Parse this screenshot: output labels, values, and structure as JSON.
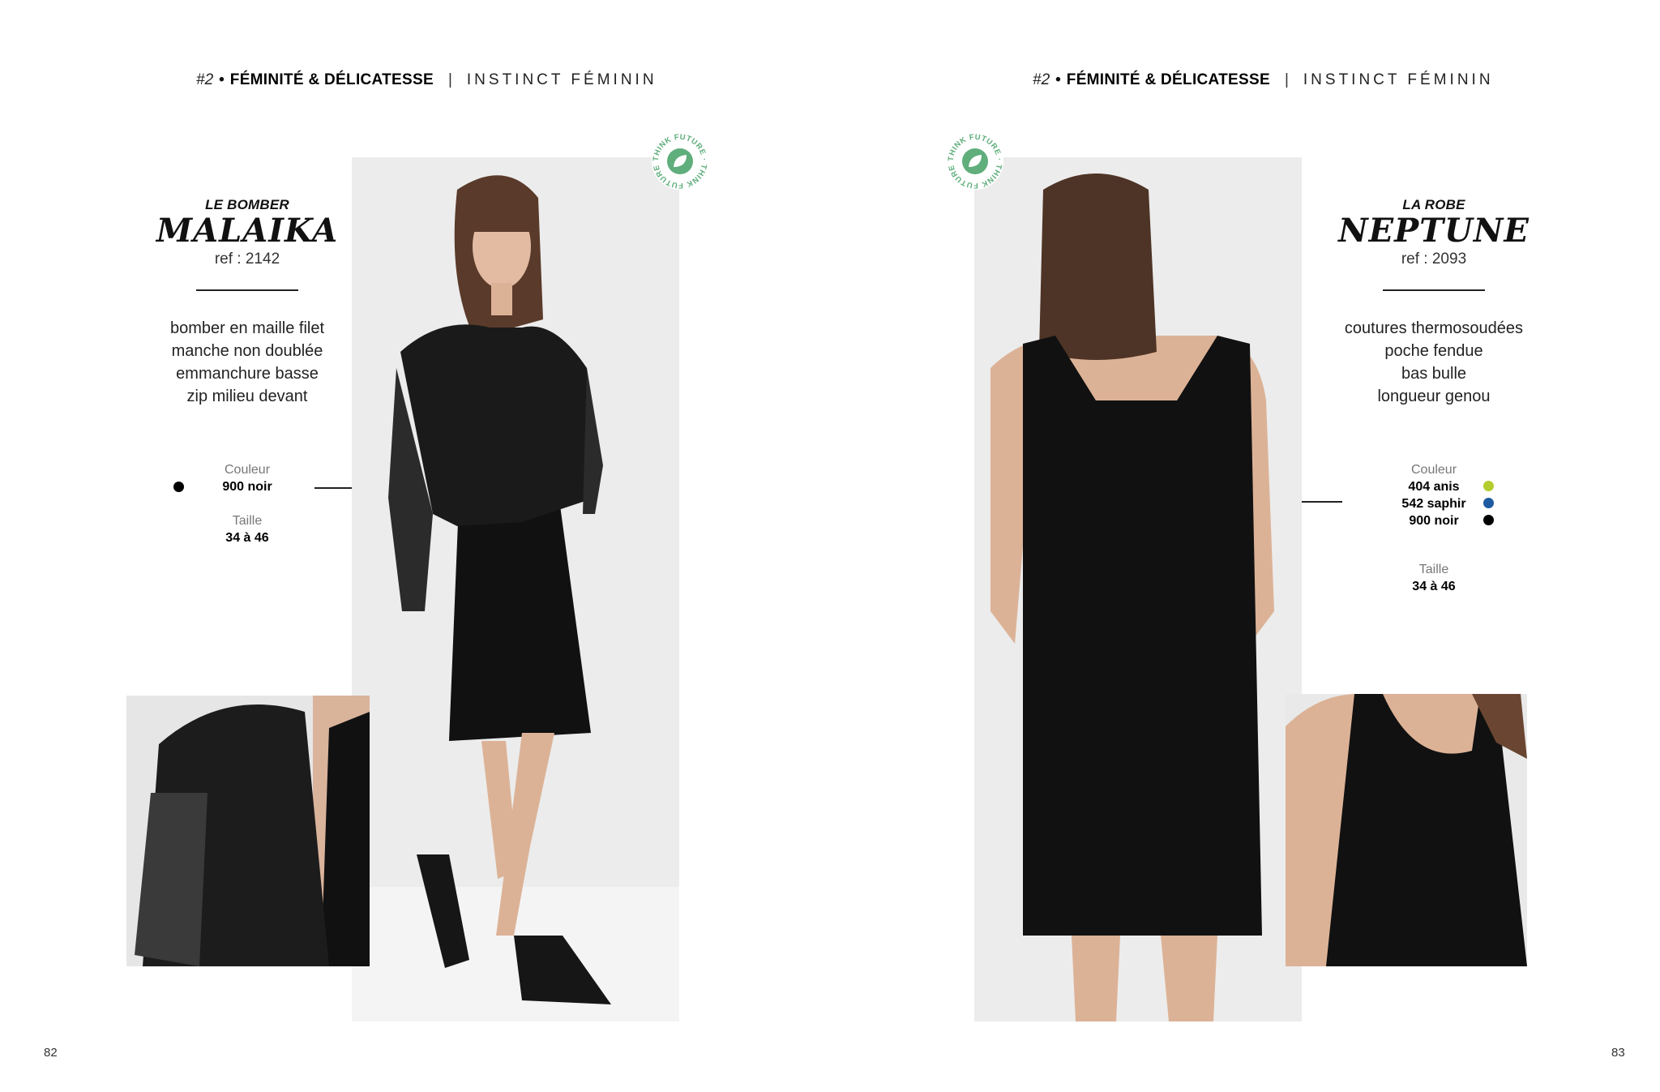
{
  "header": {
    "num": "#2",
    "dot": "•",
    "theme": "FÉMINITÉ & DÉLICATESSE",
    "sep": "|",
    "sub": "INSTINCT FÉMININ"
  },
  "badge": {
    "text": "THINK FUTURE · THINK FUTURE ·",
    "color": "#5fae7c"
  },
  "left": {
    "product": {
      "type": "LE BOMBER",
      "name": "MALAIKA",
      "ref": "ref : 2142",
      "features": [
        "bomber en maille filet",
        "manche non doublée",
        "emmanchure basse",
        "zip milieu devant"
      ]
    },
    "color_label": "Couleur",
    "colors": [
      {
        "name": "900 noir",
        "hex": "#000000"
      }
    ],
    "size_label": "Taille",
    "size": "34 à 46",
    "page_number": "82"
  },
  "right": {
    "product": {
      "type": "LA ROBE",
      "name": "NEPTUNE",
      "ref": "ref : 2093",
      "features": [
        "coutures thermosoudées",
        "poche fendue",
        "bas bulle",
        "longueur genou"
      ]
    },
    "color_label": "Couleur",
    "colors": [
      {
        "name": "404 anis",
        "hex": "#b5cc2e"
      },
      {
        "name": "542 saphir",
        "hex": "#1e5aa0"
      },
      {
        "name": "900 noir",
        "hex": "#000000"
      }
    ],
    "size_label": "Taille",
    "size": "34 à 46",
    "page_number": "83"
  }
}
